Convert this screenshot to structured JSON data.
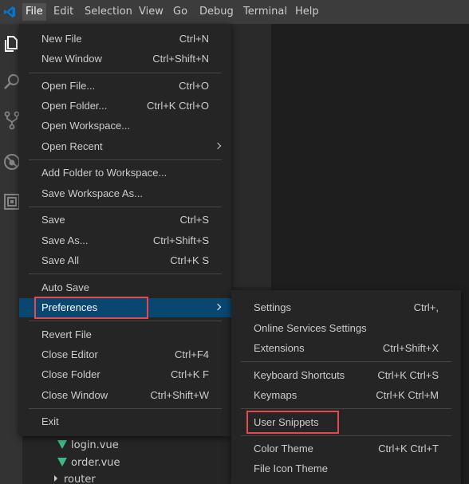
{
  "menubar": {
    "items": [
      "File",
      "Edit",
      "Selection",
      "View",
      "Go",
      "Debug",
      "Terminal",
      "Help"
    ]
  },
  "activity_icons": [
    "explorer-icon",
    "search-icon",
    "source-control-icon",
    "debug-icon",
    "extensions-icon"
  ],
  "explorer": {
    "items": [
      "login.vue",
      "order.vue",
      "router"
    ]
  },
  "file_menu": {
    "items": [
      {
        "label": "New File",
        "key": "Ctrl+N"
      },
      {
        "label": "New Window",
        "key": "Ctrl+Shift+N"
      },
      {
        "label": "Open File...",
        "key": "Ctrl+O"
      },
      {
        "label": "Open Folder...",
        "key": "Ctrl+K Ctrl+O"
      },
      {
        "label": "Open Workspace...",
        "key": ""
      },
      {
        "label": "Open Recent",
        "key": ""
      },
      {
        "label": "Add Folder to Workspace...",
        "key": ""
      },
      {
        "label": "Save Workspace As...",
        "key": ""
      },
      {
        "label": "Save",
        "key": "Ctrl+S"
      },
      {
        "label": "Save As...",
        "key": "Ctrl+Shift+S"
      },
      {
        "label": "Save All",
        "key": "Ctrl+K S"
      },
      {
        "label": "Auto Save",
        "key": ""
      },
      {
        "label": "Preferences",
        "key": ""
      },
      {
        "label": "Revert File",
        "key": ""
      },
      {
        "label": "Close Editor",
        "key": "Ctrl+F4"
      },
      {
        "label": "Close Folder",
        "key": "Ctrl+K F"
      },
      {
        "label": "Close Window",
        "key": "Ctrl+Shift+W"
      },
      {
        "label": "Exit",
        "key": ""
      }
    ]
  },
  "preferences_menu": {
    "items": [
      {
        "label": "Settings",
        "key": "Ctrl+,"
      },
      {
        "label": "Online Services Settings",
        "key": ""
      },
      {
        "label": "Extensions",
        "key": "Ctrl+Shift+X"
      },
      {
        "label": "Keyboard Shortcuts",
        "key": "Ctrl+K Ctrl+S"
      },
      {
        "label": "Keymaps",
        "key": "Ctrl+K Ctrl+M"
      },
      {
        "label": "User Snippets",
        "key": ""
      },
      {
        "label": "Color Theme",
        "key": "Ctrl+K Ctrl+T"
      },
      {
        "label": "File Icon Theme",
        "key": ""
      }
    ]
  },
  "colors": {
    "menu_bg": "#252526",
    "selection": "#094771",
    "highlight_box": "#e5484d",
    "vue_green": "#41b883",
    "vscode_blue": "#0078d4"
  }
}
